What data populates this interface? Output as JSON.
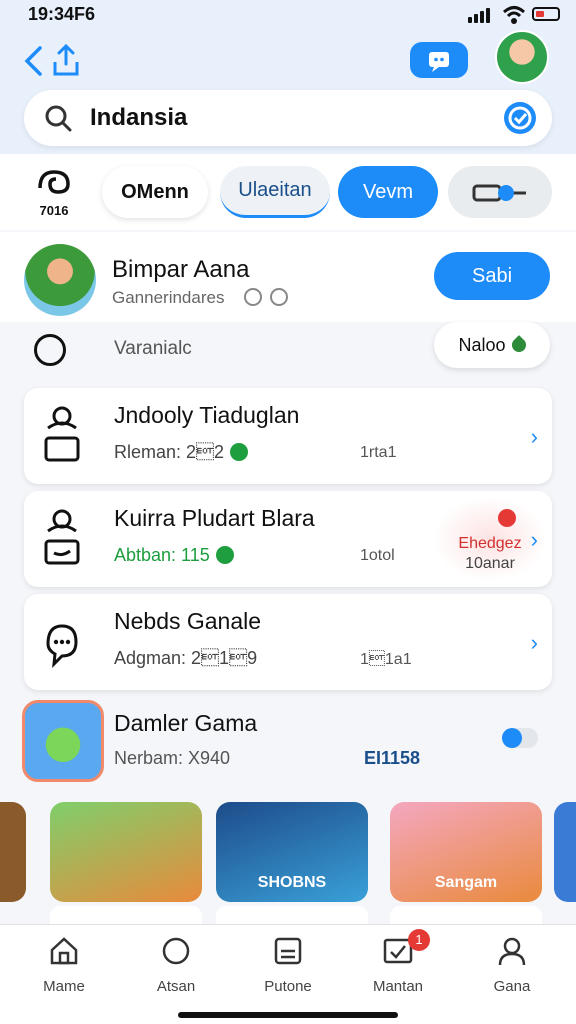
{
  "status": {
    "time": "19:34F6"
  },
  "header": {
    "search_value": "Indansia",
    "icons": [
      "back-icon",
      "share-icon",
      "chat-icon",
      "avatar",
      "search-icon",
      "verify-icon"
    ]
  },
  "tabs": {
    "logo_text": "7016",
    "items": [
      {
        "label": "OMenn"
      },
      {
        "label": "Ulaeitan"
      },
      {
        "label": "Vevm"
      }
    ]
  },
  "profile": {
    "name": "Bimpar Aana",
    "subtitle": "Gannerindares",
    "button_label": "Sabi",
    "secondary_label": "Varanialc",
    "pill_label": "Naloo"
  },
  "cards": [
    {
      "title": "Jndooly Tiaduglan",
      "meta": "Rleman: 2\u00042",
      "right": "1rta1"
    },
    {
      "title": "Kuirra Pludart Blara",
      "meta": "Abtban: 115",
      "right": "1otol",
      "hot_line1": "Ehedgez",
      "hot_line2": "10anar"
    },
    {
      "title": "Nebds Ganale",
      "meta": "Adgman: 2\u00041\u00049",
      "right": "1\u00041a1"
    }
  ],
  "game": {
    "title": "Damler Gama",
    "subtitle": "Nerbam: X940",
    "amount": "EI1158"
  },
  "carousel": [
    {
      "label": ""
    },
    {
      "label": "SHOBNS"
    },
    {
      "label": "Sangam"
    }
  ],
  "nav": {
    "items": [
      {
        "label": "Mame"
      },
      {
        "label": "Atsan"
      },
      {
        "label": "Putone"
      },
      {
        "label": "Mantan",
        "badge": "1"
      },
      {
        "label": "Gana"
      }
    ]
  },
  "colors": {
    "accent": "#1d8cf8",
    "danger": "#e53935",
    "success": "#1e9e3f"
  }
}
